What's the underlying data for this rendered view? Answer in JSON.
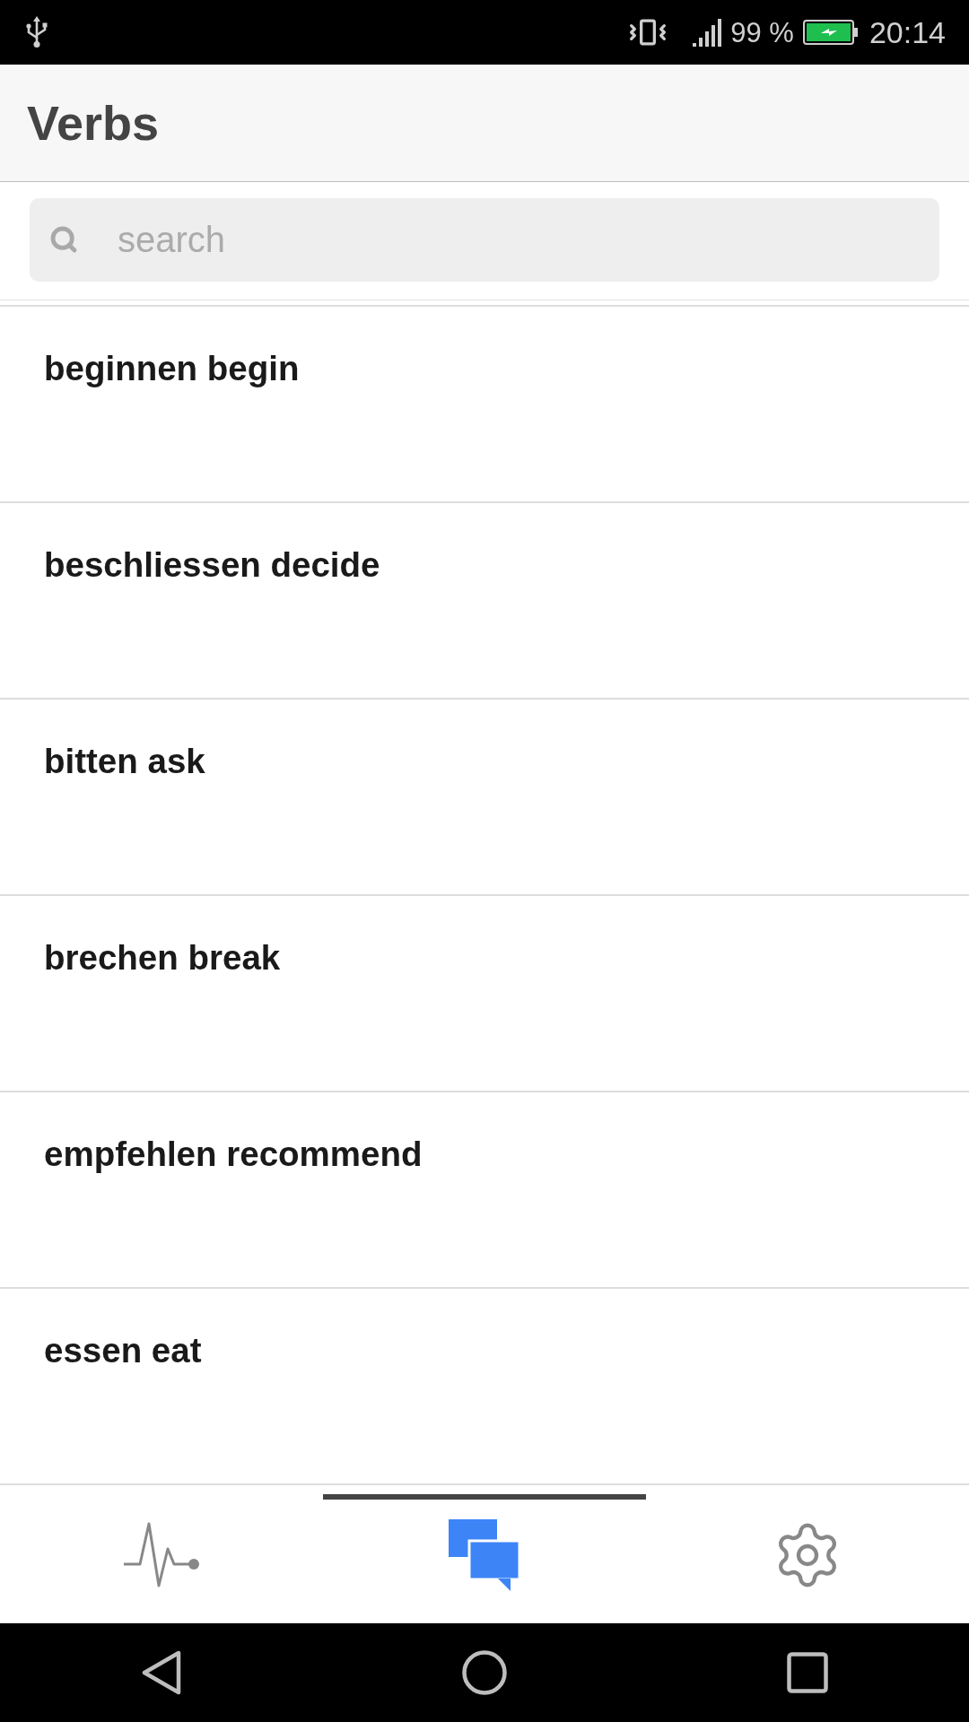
{
  "status_bar": {
    "battery_text": "99 %",
    "time": "20:14"
  },
  "header": {
    "title": "Verbs"
  },
  "search": {
    "placeholder": "search"
  },
  "verbs": [
    {
      "label": "beginnen begin"
    },
    {
      "label": "beschliessen decide"
    },
    {
      "label": "bitten ask"
    },
    {
      "label": "brechen break"
    },
    {
      "label": "empfehlen recommend"
    },
    {
      "label": "essen eat"
    }
  ],
  "bottom_tabs": [
    {
      "selected": false
    },
    {
      "selected": true
    },
    {
      "selected": false
    }
  ]
}
